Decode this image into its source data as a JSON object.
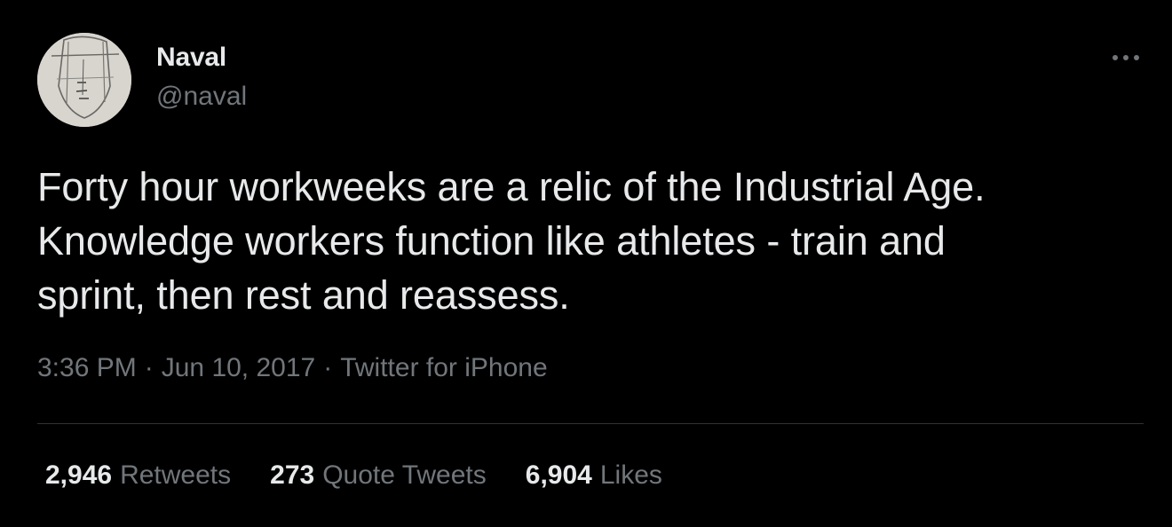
{
  "author": {
    "display_name": "Naval",
    "handle": "@naval",
    "avatar_icon": "sketched-face-avatar"
  },
  "more_icon": "ellipsis-icon",
  "tweet": {
    "text": "Forty hour workweeks are a relic of the Industrial Age.\nKnowledge workers function like athletes - train and\nsprint, then rest and reassess.",
    "time": "3:36 PM",
    "separator": "·",
    "date": "Jun 10, 2017",
    "source": "Twitter for iPhone"
  },
  "stats": [
    {
      "count": "2,946",
      "label": "Retweets"
    },
    {
      "count": "273",
      "label": "Quote Tweets"
    },
    {
      "count": "6,904",
      "label": "Likes"
    }
  ],
  "colors": {
    "background": "#000000",
    "primary_text": "#e7e9ea",
    "secondary_text": "#71767b",
    "divider": "#2f3336"
  }
}
